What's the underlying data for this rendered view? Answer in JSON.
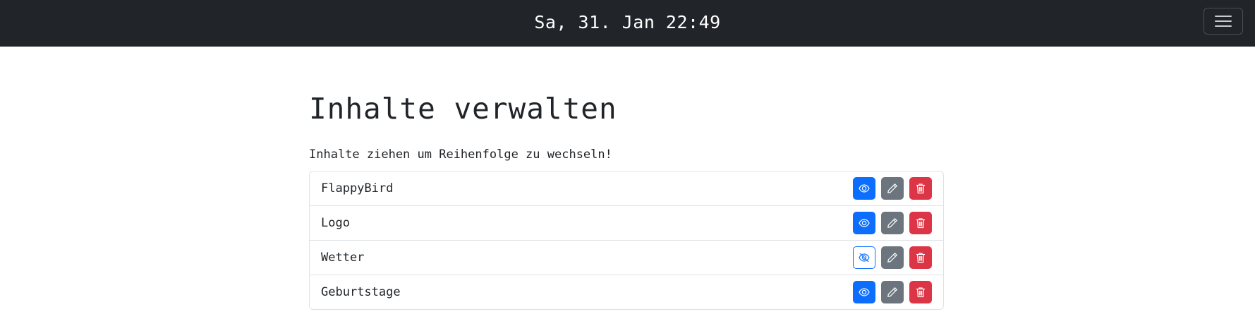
{
  "header": {
    "clock": "Sa, 31. Jan 22:49",
    "menu_icon": "hamburger-menu-icon"
  },
  "page": {
    "title": "Inhalte verwalten",
    "hint": "Inhalte ziehen um Reihenfolge zu wechseln!"
  },
  "items": [
    {
      "name": "FlappyBird",
      "visible": true
    },
    {
      "name": "Logo",
      "visible": true
    },
    {
      "name": "Wetter",
      "visible": false
    },
    {
      "name": "Geburtstage",
      "visible": true
    }
  ],
  "icons": {
    "visible": "eye-icon",
    "hidden": "eye-slash-icon",
    "edit": "pencil-icon",
    "delete": "trash-icon"
  },
  "colors": {
    "navbar": "#212529",
    "primary": "#0d6efd",
    "secondary": "#6c757d",
    "danger": "#dc3545"
  }
}
